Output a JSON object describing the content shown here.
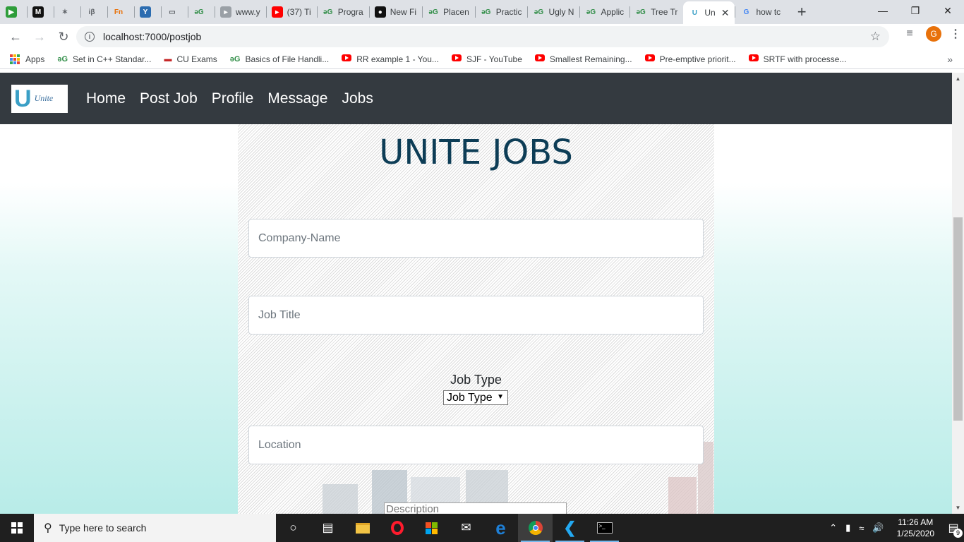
{
  "browser": {
    "tabs": [
      {
        "label": "",
        "favicon": "play-icon",
        "color": "#2e9d3a"
      },
      {
        "label": "",
        "favicon": "medium-icon",
        "color": "#111111"
      },
      {
        "label": "",
        "favicon": "spider-icon",
        "color": "#e8e8e8"
      },
      {
        "label": "",
        "favicon": "ib-icon",
        "color": "#dee1e6"
      },
      {
        "label": "",
        "favicon": "fn-icon",
        "color": "#dee1e6"
      },
      {
        "label": "",
        "favicon": "y-icon",
        "color": "#2b6cb0"
      },
      {
        "label": "",
        "favicon": "window-icon",
        "color": "#dee1e6"
      },
      {
        "label": "",
        "favicon": "gfg-icon",
        "color": "#dee1e6"
      },
      {
        "label": "www.y",
        "favicon": "video-icon",
        "color": "#9aa0a6"
      },
      {
        "label": "(37) Ti",
        "favicon": "youtube-icon",
        "color": "#ff0000"
      },
      {
        "label": "Progra",
        "favicon": "gfg-icon",
        "color": "#dee1e6"
      },
      {
        "label": "New Fi",
        "favicon": "github-icon",
        "color": "#111111"
      },
      {
        "label": "Placen",
        "favicon": "gfg-icon",
        "color": "#dee1e6"
      },
      {
        "label": "Practic",
        "favicon": "gfg-icon",
        "color": "#dee1e6"
      },
      {
        "label": "Ugly N",
        "favicon": "gfg-icon",
        "color": "#dee1e6"
      },
      {
        "label": "Applic",
        "favicon": "gfg-icon",
        "color": "#dee1e6"
      },
      {
        "label": "Tree Tr",
        "favicon": "gfg-icon",
        "color": "#dee1e6"
      },
      {
        "label": "Un",
        "favicon": "unite-icon",
        "color": "#ffffff",
        "active": true
      },
      {
        "label": "how tc",
        "favicon": "google-icon",
        "color": "#dee1e6"
      }
    ],
    "new_tab": "+",
    "url": "localhost:7000/postjob",
    "avatar_letter": "G",
    "bookmarks": [
      {
        "label": "Apps",
        "icon": "apps-icon"
      },
      {
        "label": "Set in C++ Standar...",
        "icon": "gfg-icon"
      },
      {
        "label": "CU Exams",
        "icon": "cu-icon"
      },
      {
        "label": "Basics of File Handli...",
        "icon": "gfg-icon"
      },
      {
        "label": "RR example 1 - You...",
        "icon": "youtube-icon"
      },
      {
        "label": "SJF - YouTube",
        "icon": "youtube-icon"
      },
      {
        "label": "Smallest Remaining...",
        "icon": "youtube-icon"
      },
      {
        "label": "Pre-emptive priorit...",
        "icon": "youtube-icon"
      },
      {
        "label": "SRTF with processe...",
        "icon": "youtube-icon"
      }
    ],
    "bookmarks_more": "»"
  },
  "site": {
    "logo_text": "Unite",
    "nav": [
      "Home",
      "Post Job",
      "Profile",
      "Message",
      "Jobs"
    ],
    "heading": "UNITE JOBS",
    "form": {
      "company_placeholder": "Company-Name",
      "title_placeholder": "Job Title",
      "job_type_label": "Job Type",
      "job_type_selected": "Job Type",
      "location_placeholder": "Location",
      "description_placeholder": "Description"
    }
  },
  "taskbar": {
    "search_placeholder": "Type here to search",
    "time": "11:26 AM",
    "date": "1/25/2020",
    "notification_count": "9"
  }
}
